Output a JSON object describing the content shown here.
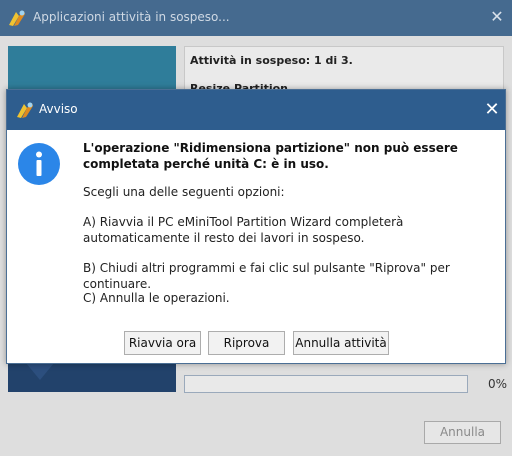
{
  "background_window": {
    "title": "Applicazioni attività in sospeso...",
    "pending_status": "Attività in sospeso: 1 di 3.",
    "current_operation": "Resize Partition",
    "progress": {
      "fraction": 0.0,
      "label": "0%"
    },
    "cancel_label": "Annulla"
  },
  "dialog": {
    "title": "Avviso",
    "main_message": "L'operazione \"Ridimensiona partizione\" non può essere completata perché unità C: è in uso.",
    "choose_text": "Scegli una delle seguenti opzioni:",
    "option_a": "A) Riavvia il PC eMiniTool Partition Wizard completerà automaticamente il resto dei lavori in sospeso.",
    "option_b": "B) Chiudi altri programmi e fai clic sul pulsante \"Riprova\" per continuare.",
    "option_c": "C) Annulla le operazioni.",
    "buttons": {
      "reboot": "Riavvia ora",
      "retry": "Riprova",
      "cancel_all": "Annulla attività"
    }
  },
  "icons": {
    "app_logo": "app-logo-icon",
    "close": "close-icon",
    "info": "info-icon"
  },
  "colors": {
    "titlebar": "#2e5d8e",
    "info_icon": "#2b86e8",
    "bg_titlebar": "#456a8f"
  }
}
